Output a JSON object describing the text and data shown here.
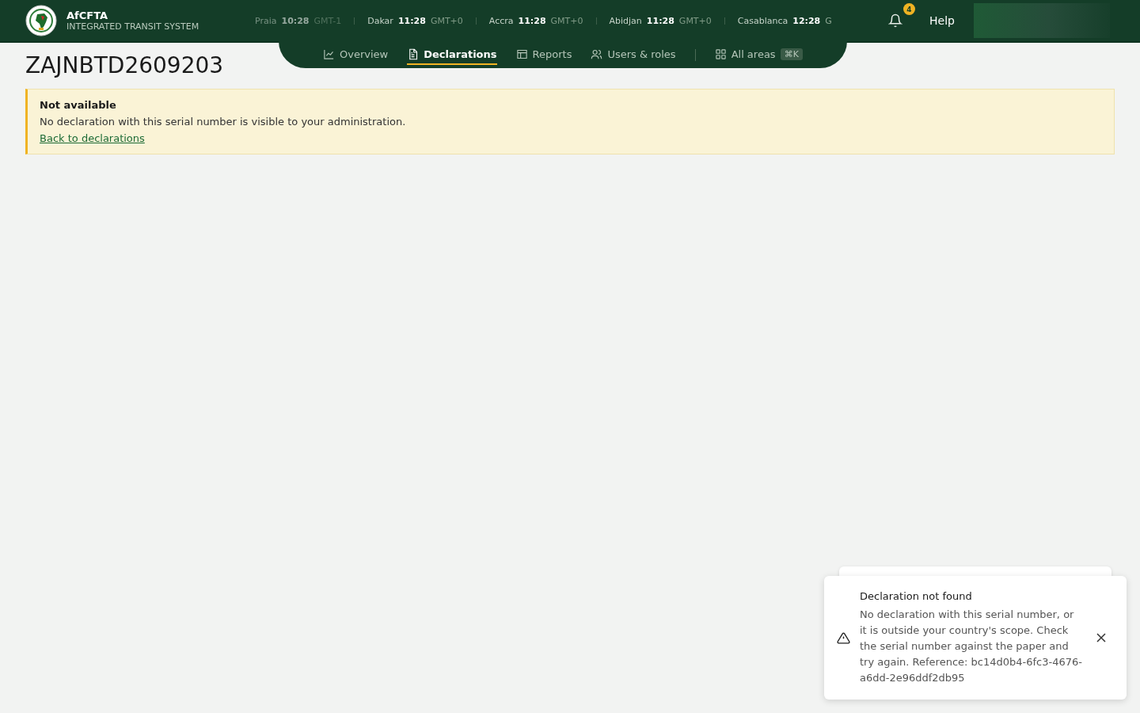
{
  "brand": {
    "name": "AfCFTA",
    "subtitle": "INTEGRATED TRANSIT SYSTEM"
  },
  "clocks": [
    {
      "city": "Praia",
      "time": "10:28",
      "zone": "GMT-1",
      "faded": true
    },
    {
      "city": "Dakar",
      "time": "11:28",
      "zone": "GMT+0",
      "faded": false
    },
    {
      "city": "Accra",
      "time": "11:28",
      "zone": "GMT+0",
      "faded": false
    },
    {
      "city": "Abidjan",
      "time": "11:28",
      "zone": "GMT+0",
      "faded": false
    },
    {
      "city": "Casablanca",
      "time": "12:28",
      "zone": "G",
      "faded": false
    }
  ],
  "notifications": {
    "count": "4"
  },
  "help": "Help",
  "tabs": [
    {
      "label": "Overview",
      "kind": "chart",
      "selected": false
    },
    {
      "label": "Declarations",
      "kind": "doc",
      "selected": true
    },
    {
      "label": "Reports",
      "kind": "table",
      "selected": false
    },
    {
      "label": "Users & roles",
      "kind": "users",
      "selected": false
    },
    {
      "label": "All areas",
      "kind": "grid",
      "selected": false,
      "shortcut": "⌘K"
    }
  ],
  "page_title": "ZAJNBTD2609203",
  "alert": {
    "title": "Not available",
    "message": "No declaration with this serial number is visible to your administration.",
    "link": "Back to declarations"
  },
  "toast": {
    "title": "Declaration not found",
    "message": "No declaration with this serial number, or it is outside your country's scope. Check the serial number against the paper and try again. Reference: bc14d0b4-6fc3-4676-a6dd-2e96ddf2db95"
  }
}
